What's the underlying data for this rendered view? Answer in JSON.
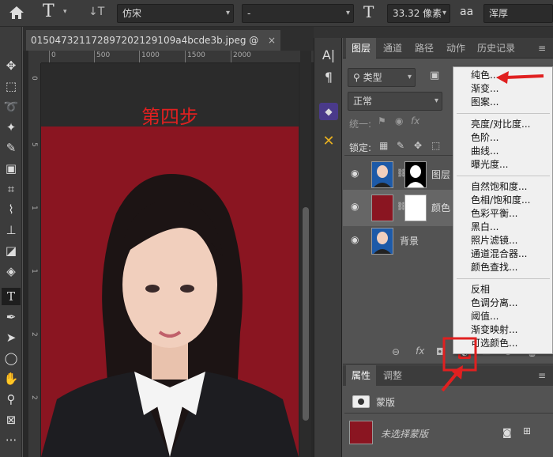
{
  "options_bar": {
    "home_icon": "home-icon",
    "text_tool_glyph": "T",
    "orient_glyph": "↓T",
    "font_family": "仿宋",
    "font_style": "-",
    "size_glyph": "T",
    "font_size": "33.32 像素",
    "aa_glyph": "aa",
    "aa_mode": "浑厚"
  },
  "document": {
    "tab_title": "015047321172897202129109a4bcde3b.jpeg @ 16...",
    "close_glyph": "×",
    "ruler_top": [
      "0",
      "500",
      "1000",
      "1500",
      "2000"
    ],
    "ruler_left": [
      "0",
      "5",
      "1",
      "1",
      "2",
      "2"
    ],
    "annotation": "第四步",
    "background_color": "#8a1521"
  },
  "panels": {
    "tabs": [
      "图层",
      "通道",
      "路径",
      "动作",
      "历史记录"
    ],
    "filter_label": "类型",
    "blend_mode": "正常",
    "unify_label": "统一:",
    "lock_label": "锁定:",
    "layers": [
      {
        "name": "图层",
        "thumb": "photo"
      },
      {
        "name": "颜色",
        "thumb": "color"
      },
      {
        "name": "背景",
        "thumb": "photo"
      }
    ],
    "bottom_icons": [
      "link-icon",
      "fx-icon",
      "mask-icon",
      "adjustment-icon",
      "group-icon",
      "new-layer-icon",
      "trash-icon"
    ],
    "fx_glyph": "fx"
  },
  "adjust_menu": {
    "items_group1": [
      "纯色...",
      "渐变...",
      "图案..."
    ],
    "items_group2": [
      "亮度/对比度...",
      "色阶...",
      "曲线...",
      "曝光度..."
    ],
    "items_group3": [
      "自然饱和度...",
      "色相/饱和度...",
      "色彩平衡...",
      "黑白...",
      "照片滤镜...",
      "通道混合器...",
      "颜色查找..."
    ],
    "items_group4": [
      "反相",
      "色调分离...",
      "阈值...",
      "渐变映射...",
      "可选颜色..."
    ]
  },
  "properties": {
    "tabs": [
      "属性",
      "调整"
    ],
    "mask_label": "蒙版",
    "selection_label": "未选择蒙版"
  },
  "accent_red": "#e02020"
}
